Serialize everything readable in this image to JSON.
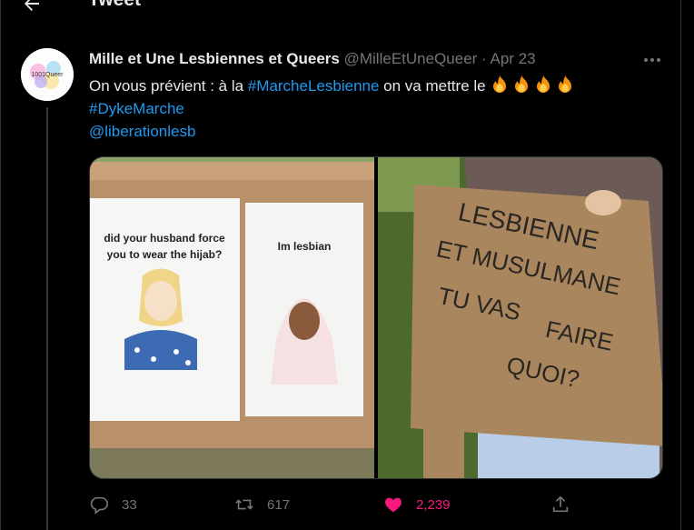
{
  "header": {
    "title": "Tweet"
  },
  "tweet": {
    "author_name": "Mille et Une Lesbiennes et Queers",
    "handle": "@MilleEtUneQueer",
    "separator": "·",
    "date": "Apr 23",
    "text_prefix": "On vous prévient : à la ",
    "hashtag1": "#MarcheLesbienne",
    "text_middle": " on va mettre le ",
    "hashtag2": "#DykeMarche",
    "mention": "@liberationlesb",
    "avatar_text": "1001Queer"
  },
  "media": {
    "image1": {
      "left_caption": "did your husband force you to wear the hijab?",
      "right_caption": "Im lesbian"
    },
    "image2": {
      "sign_line1": "LESBIENNE",
      "sign_line2": "ET MUSULMANE",
      "sign_line3": "TU VAS",
      "sign_line4": "FAIRE",
      "sign_line5": "QUOI?"
    }
  },
  "actions": {
    "replies": "33",
    "retweets": "617",
    "likes": "2,239"
  },
  "colors": {
    "link": "#1d9bf0",
    "like": "#f91880",
    "muted": "#71767b"
  },
  "icons": [
    "back-arrow-icon",
    "more-icon",
    "fire-emoji",
    "reply-icon",
    "retweet-icon",
    "heart-icon",
    "share-icon"
  ]
}
